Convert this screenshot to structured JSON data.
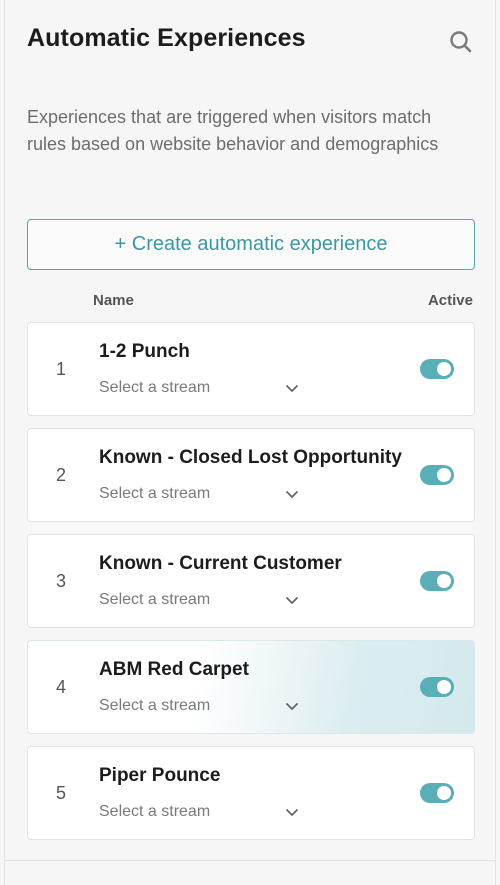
{
  "header": {
    "title": "Automatic Experiences",
    "search_icon": "search-icon"
  },
  "description": "Experiences that are triggered when visitors match rules based on website behavior and demographics",
  "create_button": "+ Create automatic experience",
  "columns": {
    "name": "Name",
    "active": "Active"
  },
  "experiences": [
    {
      "index": "1",
      "name": "1-2 Punch",
      "stream_placeholder": "Select a stream",
      "active": true
    },
    {
      "index": "2",
      "name": "Known - Closed Lost Opportunity",
      "stream_placeholder": "Select a stream",
      "active": true
    },
    {
      "index": "3",
      "name": "Known - Current Customer",
      "stream_placeholder": "Select a stream",
      "active": true
    },
    {
      "index": "4",
      "name": "ABM Red Carpet",
      "stream_placeholder": "Select a stream",
      "active": true
    },
    {
      "index": "5",
      "name": "Piper Pounce",
      "stream_placeholder": "Select a stream",
      "active": true
    }
  ],
  "colors": {
    "accent": "#3c97a3",
    "toggle_on": "#5aaeb8",
    "highlight_row": "#d4e9ed"
  }
}
